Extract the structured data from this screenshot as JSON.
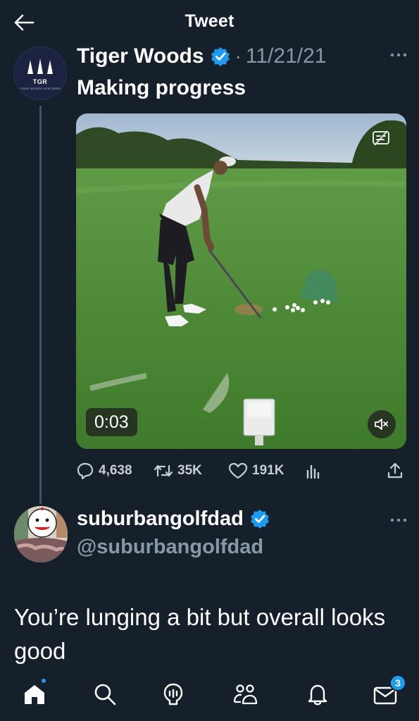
{
  "header": {
    "title": "Tweet"
  },
  "tweet": {
    "avatar_letters": "TGR",
    "avatar_subtitle": "TIGER WOODS VENTURES",
    "author_name": "Tiger Woods",
    "separator": "·",
    "date": "11/21/21",
    "text": "Making progress",
    "media": {
      "timestamp": "0:03"
    },
    "actions": {
      "replies": "4,638",
      "retweets": "35K",
      "likes": "191K"
    }
  },
  "reply": {
    "author_name": "suburbangolfdad",
    "handle": "@suburbangolfdad",
    "text": "You’re lunging a bit but overall looks good"
  },
  "bottom_nav": {
    "messages_badge": "3"
  },
  "colors": {
    "background": "#15202b",
    "accent": "#1d9bf0",
    "muted_text": "#8899a6"
  },
  "icons": [
    "back-arrow-icon",
    "verified-badge-icon",
    "more-icon",
    "captions-icon",
    "mute-icon",
    "reply-icon",
    "retweet-icon",
    "like-icon",
    "analytics-icon",
    "share-icon",
    "home-icon",
    "search-icon",
    "spaces-icon",
    "communities-icon",
    "notifications-icon",
    "messages-icon"
  ]
}
